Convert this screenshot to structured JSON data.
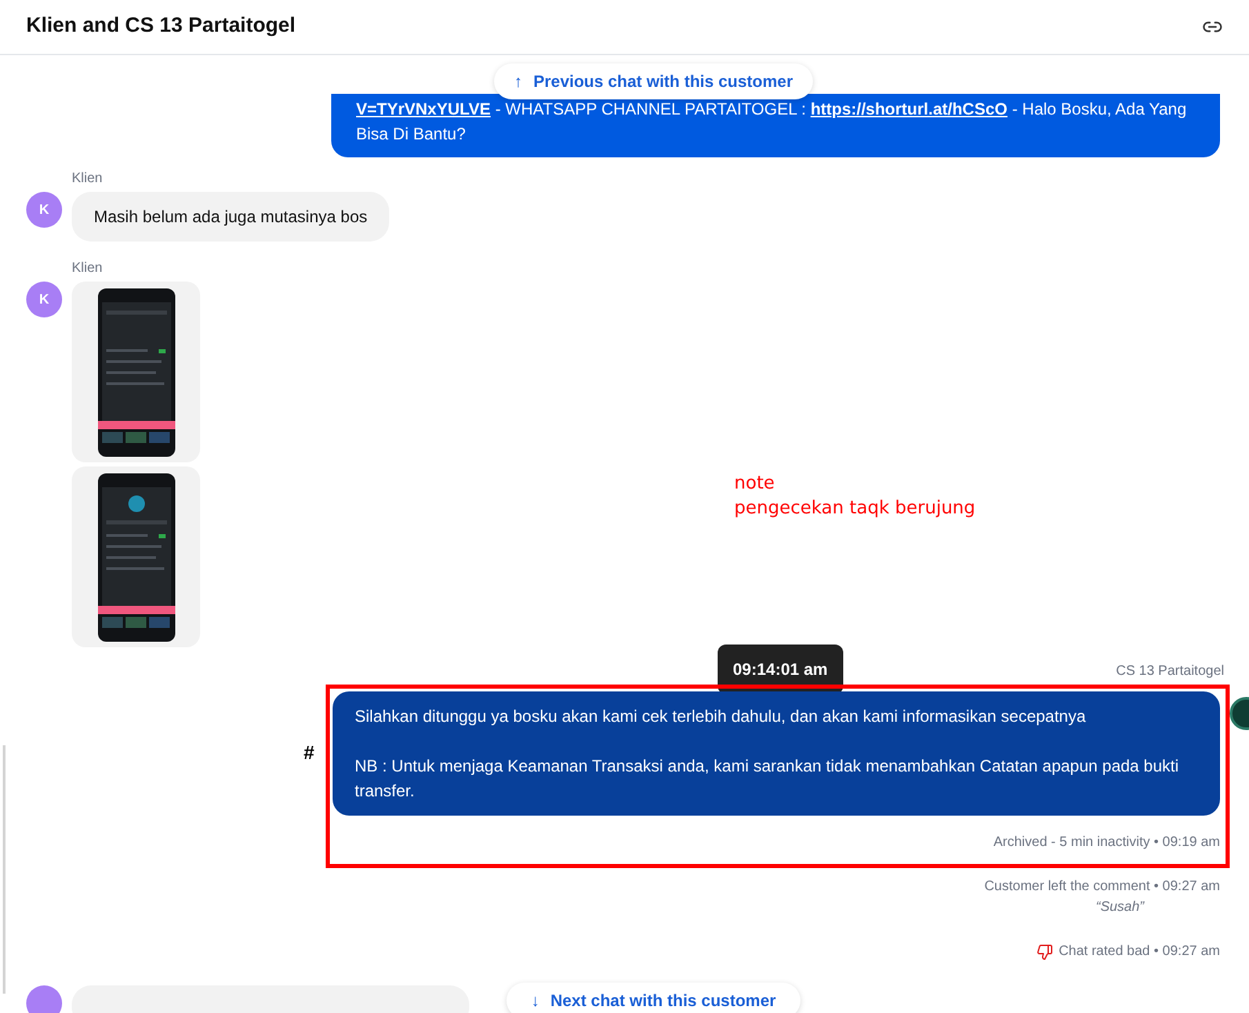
{
  "header": {
    "title": "Klien and CS 13 Partaitogel"
  },
  "previous_chat": {
    "label": "Previous chat with this customer",
    "arrow": "↑"
  },
  "next_chat": {
    "label": "Next chat with this customer",
    "arrow": "↓"
  },
  "messages": [
    {
      "kind": "agent_text",
      "parts": [
        {
          "text": "V=TYrVNxYULVE",
          "link": true
        },
        {
          "text": " - WHATSAPP CHANNEL PARTAITOGEL : ",
          "link": false
        },
        {
          "text": "https://shorturl.at/hCScO",
          "link": true
        },
        {
          "text": " - Halo Bosku, Ada Yang Bisa Di Bantu?",
          "link": false
        }
      ]
    },
    {
      "kind": "client_text",
      "sender": "Klien",
      "avatar": "K",
      "text": "Masih belum ada juga mutasinya bos"
    },
    {
      "kind": "client_images",
      "sender": "Klien",
      "avatar": "K"
    },
    {
      "kind": "agent_highlighted",
      "sender": "CS 13 Partaitogel",
      "tooltip": "09:14:01 am",
      "mark": "#",
      "paragraphs": [
        "Silahkan ditunggu ya bosku akan kami cek terlebih dahulu, dan akan kami informasikan secepatnya",
        "NB : Untuk menjaga Keamanan Transaksi anda, kami sarankan tidak menambahkan Catatan apapun pada bukti transfer."
      ],
      "status": "Archived - 5 min inactivity • 09:19 am"
    }
  ],
  "events": [
    {
      "kind": "comment",
      "text": "Customer left the comment • 09:27 am",
      "comment": "“Susah”"
    },
    {
      "kind": "rating",
      "text": "Chat rated bad • 09:27 am"
    }
  ],
  "annotation": {
    "lines": [
      "note",
      "pengecekan taqk berujung"
    ]
  }
}
